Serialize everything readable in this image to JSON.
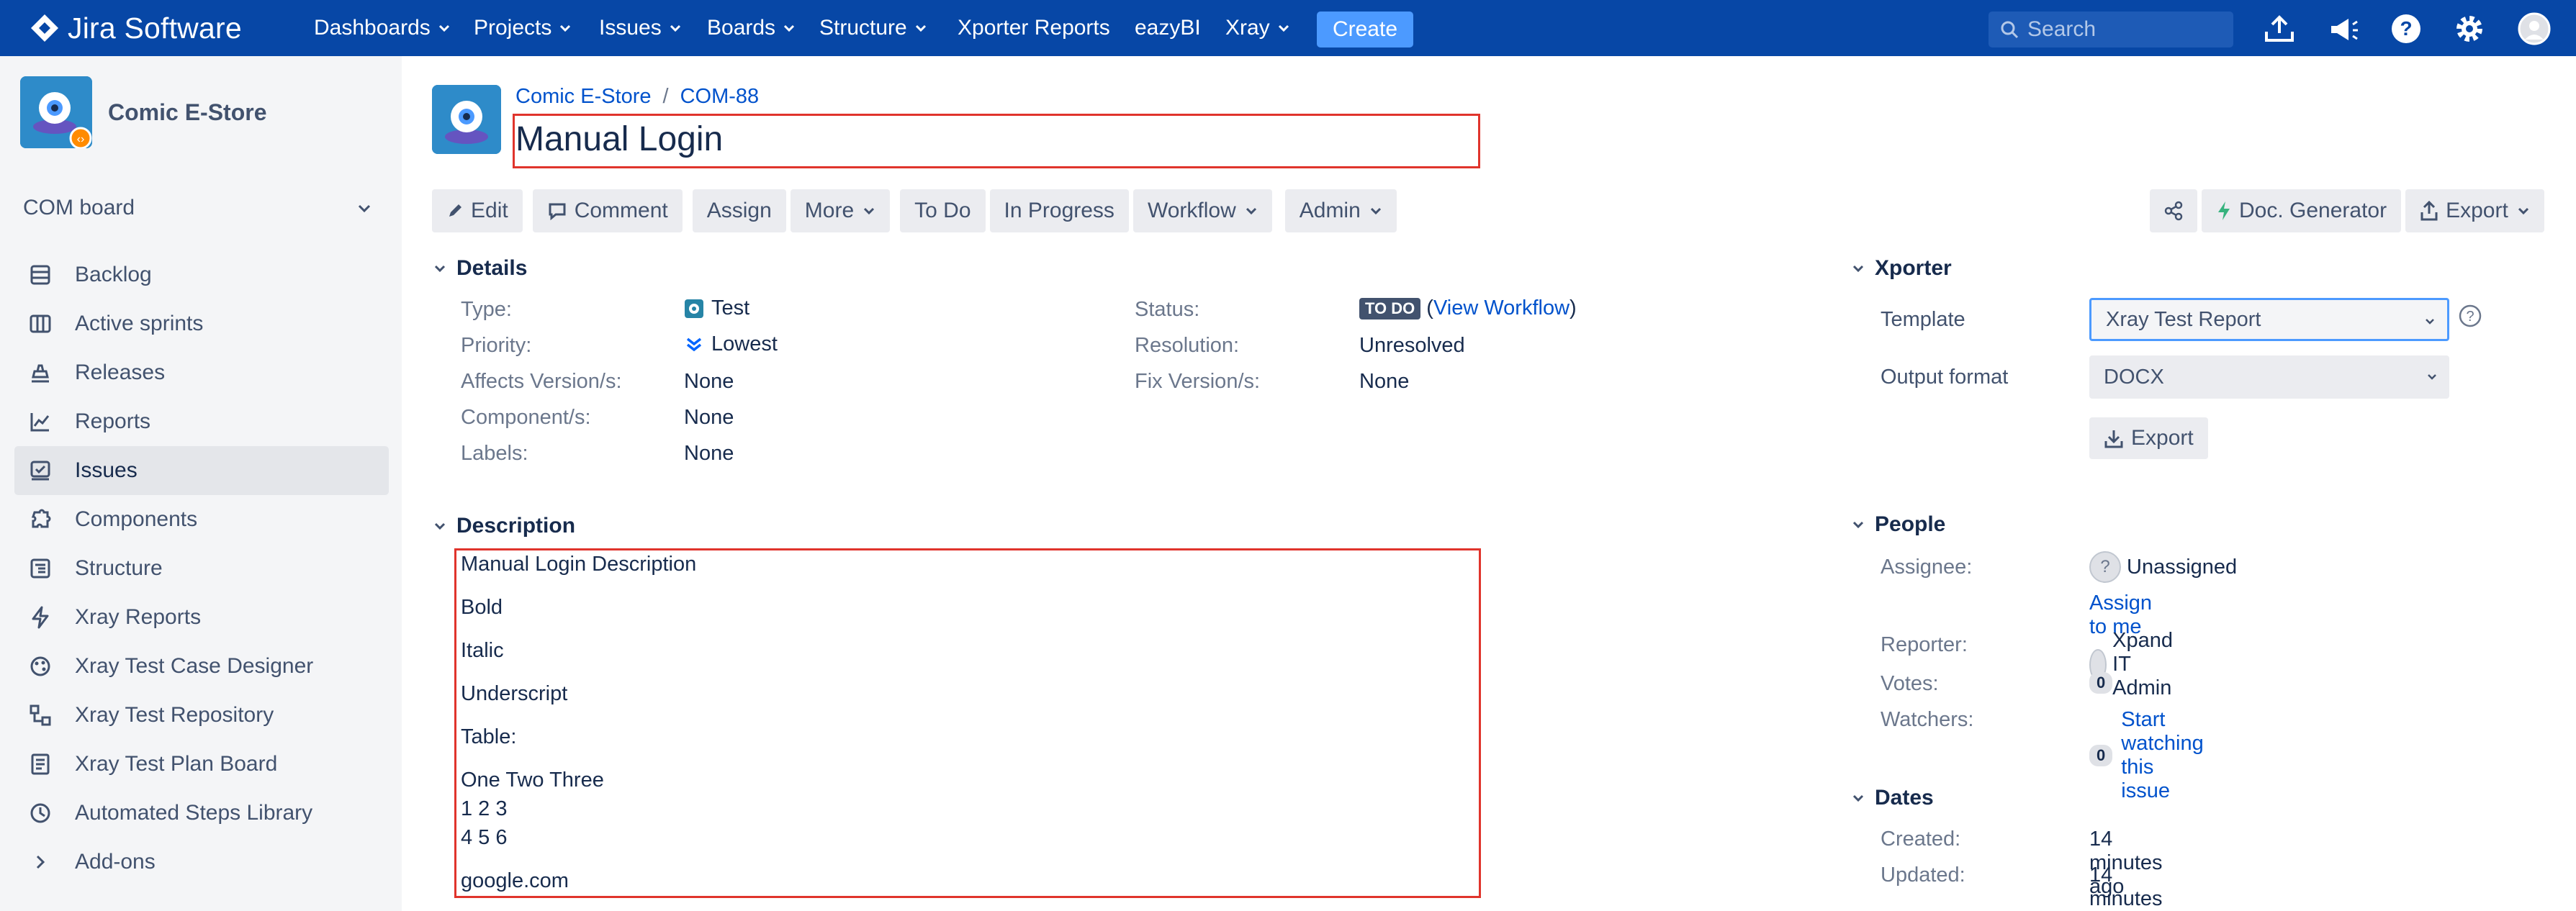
{
  "topnav": {
    "logo": "Jira Software",
    "items": [
      "Dashboards",
      "Projects",
      "Issues",
      "Boards",
      "Structure",
      "Xporter Reports",
      "eazyBI",
      "Xray"
    ],
    "item_has_caret": [
      true,
      true,
      true,
      true,
      true,
      false,
      false,
      true
    ],
    "create": "Create",
    "search_placeholder": "Search",
    "brand_color": "#0747a6"
  },
  "sidebar": {
    "project_name": "Comic E-Store",
    "board": "COM board",
    "items": [
      {
        "label": "Backlog",
        "icon": "backlog-icon",
        "active": false
      },
      {
        "label": "Active sprints",
        "icon": "active-sprints-icon",
        "active": false
      },
      {
        "label": "Releases",
        "icon": "releases-icon",
        "active": false
      },
      {
        "label": "Reports",
        "icon": "reports-icon",
        "active": false
      },
      {
        "label": "Issues",
        "icon": "issues-icon",
        "active": true
      },
      {
        "label": "Components",
        "icon": "components-icon",
        "active": false
      },
      {
        "label": "Structure",
        "icon": "structure-icon",
        "active": false
      },
      {
        "label": "Xray Reports",
        "icon": "xray-reports-icon",
        "active": false
      },
      {
        "label": "Xray Test Case Designer",
        "icon": "test-case-designer-icon",
        "active": false
      },
      {
        "label": "Xray Test Repository",
        "icon": "test-repository-icon",
        "active": false
      },
      {
        "label": "Xray Test Plan Board",
        "icon": "test-plan-board-icon",
        "active": false
      },
      {
        "label": "Automated Steps Library",
        "icon": "automated-steps-icon",
        "active": false
      },
      {
        "label": "Add-ons",
        "icon": "chevron-right-icon",
        "active": false
      }
    ]
  },
  "issue": {
    "breadcrumb_project": "Comic E-Store",
    "breadcrumb_key": "COM-88",
    "title": "Manual Login"
  },
  "toolbar": {
    "edit": "Edit",
    "comment": "Comment",
    "assign": "Assign",
    "more": "More",
    "todo": "To Do",
    "in_progress": "In Progress",
    "workflow": "Workflow",
    "admin": "Admin",
    "doc_generator": "Doc. Generator",
    "export": "Export"
  },
  "details": {
    "heading": "Details",
    "type_label": "Type:",
    "type_value": "Test",
    "priority_label": "Priority:",
    "priority_value": "Lowest",
    "affects_label": "Affects Version/s:",
    "affects_value": "None",
    "component_label": "Component/s:",
    "component_value": "None",
    "labels_label": "Labels:",
    "labels_value": "None",
    "status_label": "Status:",
    "status_value": "TO DO",
    "view_workflow": "View Workflow",
    "resolution_label": "Resolution:",
    "resolution_value": "Unresolved",
    "fix_label": "Fix Version/s:",
    "fix_value": "None"
  },
  "description": {
    "heading": "Description",
    "lines": [
      "Manual Login Description",
      "Bold",
      "Italic",
      "Underscript",
      "Table:",
      "One Two Three",
      "1 2 3",
      "4 5 6",
      "google.com"
    ]
  },
  "xporter": {
    "heading": "Xporter",
    "template_label": "Template",
    "template_value": "Xray Test Report",
    "output_label": "Output format",
    "output_value": "DOCX",
    "export_button": "Export"
  },
  "people": {
    "heading": "People",
    "assignee_label": "Assignee:",
    "assignee_value": "Unassigned",
    "assign_to_me": "Assign to me",
    "reporter_label": "Reporter:",
    "reporter_value": "Xpand IT Admin",
    "votes_label": "Votes:",
    "votes_count": "0",
    "watchers_label": "Watchers:",
    "watchers_count": "0",
    "start_watching": "Start watching this issue"
  },
  "dates": {
    "heading": "Dates",
    "created_label": "Created:",
    "created_value": "14 minutes ago",
    "updated_label": "Updated:",
    "updated_value": "14 minutes ago"
  }
}
